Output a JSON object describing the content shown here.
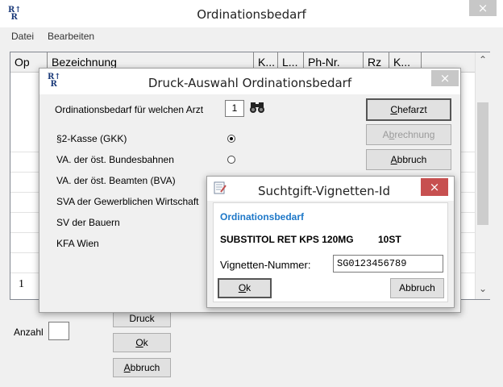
{
  "main_window": {
    "title": "Ordinationsbedarf",
    "close": "×",
    "menu": [
      "Datei",
      "Bearbeiten"
    ],
    "columns": [
      "Op",
      "Bezeichnung",
      "K...",
      "L...",
      "Ph-Nr.",
      "Rz",
      "K..."
    ],
    "row_value": "1",
    "scroll_up": "⌃",
    "scroll_down": "⌄",
    "anzahl_label": "Anzahl",
    "druck_button": "Druck",
    "ok_prefix": "",
    "ok_u": "O",
    "ok_rest": "k",
    "abbruch_u": "A",
    "abbruch_rest": "bbruch"
  },
  "druck_dialog": {
    "title": "Druck-Auswahl Ordinationsbedarf",
    "close": "×",
    "arzt_label": "Ordinationsbedarf für welchen Arzt",
    "arzt_value": "1",
    "binoculars": "👓",
    "chefarzt_u": "C",
    "chefarzt_rest": "hefarzt",
    "abrechnung_pre": "A",
    "abrechnung_u": "b",
    "abrechnung_rest": "rechnung",
    "abbruch_u": "A",
    "abbruch_rest": "bbruch",
    "options": [
      {
        "label": "§2-Kasse (GKK)",
        "selected": true
      },
      {
        "label": "VA. der öst. Bundesbahnen",
        "selected": false
      },
      {
        "label": "VA. der öst. Beamten (BVA)",
        "selected": false
      },
      {
        "label": "SVA der Gewerblichen Wirtschaft",
        "selected": false
      },
      {
        "label": "SV der Bauern",
        "selected": false
      },
      {
        "label": "KFA Wien",
        "selected": false
      }
    ]
  },
  "vignette_dialog": {
    "title": "Suchtgift-Vignetten-Id",
    "close": "×",
    "group": "Ordinationsbedarf",
    "product": "SUBSTITOL RET KPS 120MG",
    "quantity": "10ST",
    "nummer_label": "Vignetten-Nummer:",
    "nummer_value": "SG0123456789",
    "ok_u": "O",
    "ok_rest": "k",
    "abbruch": "Abbruch",
    "accent": "#1e78c8"
  }
}
